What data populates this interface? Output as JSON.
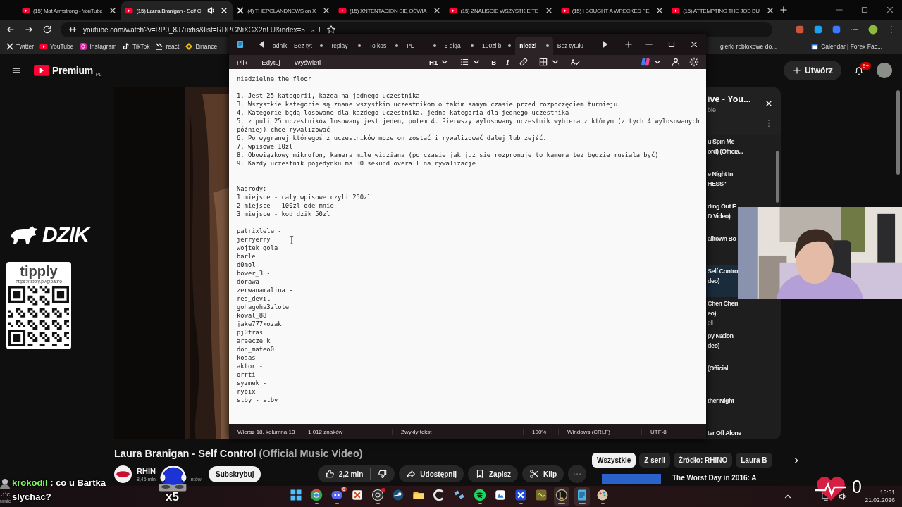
{
  "browser": {
    "tabs": [
      {
        "title": "(15) Mat Armstrong - YouTube",
        "kind": "youtube",
        "selected": false,
        "playing": false
      },
      {
        "title": "(15) Laura Branigan - Self C",
        "kind": "youtube",
        "selected": true,
        "playing": true
      },
      {
        "title": "(4) THEPOLANDNEWS on X",
        "kind": "x",
        "selected": false,
        "playing": false
      },
      {
        "title": "(15) XNTENTACION SIĘ OŚWIA",
        "kind": "youtube",
        "selected": false,
        "playing": false
      },
      {
        "title": "(15) ZNALIŚCIE WSZYSTKIE TE",
        "kind": "youtube",
        "selected": false,
        "playing": false
      },
      {
        "title": "(15) I BOUGHT A WRECKED FE",
        "kind": "youtube",
        "selected": false,
        "playing": false
      },
      {
        "title": "(15) ATTEMPTING THE JOB BU",
        "kind": "youtube",
        "selected": false,
        "playing": false
      }
    ],
    "address": "youtube.com/watch?v=RP0_8J7uxhs&list=RDPGNiXGX2nLU&index=5",
    "bookmarks": [
      {
        "label": "Twitter",
        "kind": "x"
      },
      {
        "label": "YouTube",
        "kind": "youtube"
      },
      {
        "label": "Instagram",
        "kind": "instagram"
      },
      {
        "label": "TikTok",
        "kind": "tiktok"
      },
      {
        "label": "react",
        "kind": "react"
      },
      {
        "label": "Binance",
        "kind": "binance"
      }
    ],
    "bookmarks_right": [
      {
        "label": "gierki robloxowe do...",
        "kind": "none"
      },
      {
        "label": "Calendar | Forex Fac...",
        "kind": "page"
      }
    ]
  },
  "youtube": {
    "logo": "Premium",
    "region": "PL",
    "create": "Utwórz",
    "notifications": "9+",
    "playlist": {
      "title": "ive - You...",
      "subtitle": "bie",
      "items": [
        {
          "lines": [
            "u Spin Me",
            "ord) (Officia..."
          ],
          "selected": false
        },
        {
          "lines": [
            "e Night In",
            "HESS\""
          ],
          "selected": false
        },
        {
          "lines": [
            "ding Out F",
            "D Video)"
          ],
          "selected": false
        },
        {
          "lines": [
            "alltown Bo"
          ],
          "selected": false
        },
        {
          "lines": [
            "Self Contro",
            "deo)"
          ],
          "selected": true
        },
        {
          "lines": [
            "Cheri Cheri",
            "eo)",
            "ell"
          ],
          "selected": false
        },
        {
          "lines": [
            "py Nation",
            "deo)"
          ],
          "selected": false
        },
        {
          "lines": [
            "(Official"
          ],
          "selected": false
        },
        {
          "lines": [
            "ther Night"
          ],
          "selected": false
        },
        {
          "lines": [
            "ter Off Alone"
          ],
          "selected": false
        }
      ]
    },
    "video": {
      "title": "Laura Branigan - Self Control",
      "title_suffix": "(Official Music Video)",
      "channel": "RHIN",
      "subscribers": "8,45 mln",
      "subscribers_tail": "ntów",
      "subscribe": "Subskrybuj",
      "likes": "2,2 mln",
      "actions": [
        {
          "label": "Udostępnij",
          "kind": "share"
        },
        {
          "label": "Zapisz",
          "kind": "save"
        },
        {
          "label": "Klip",
          "kind": "clip"
        }
      ]
    },
    "chips": [
      {
        "label": "Wszystkie",
        "selected": true
      },
      {
        "label": "Z serii",
        "selected": false
      },
      {
        "label": "Źródło: RHINO",
        "selected": false
      },
      {
        "label": "Laura B",
        "selected": false
      }
    ],
    "next_video": {
      "title": "The Worst Day in 2016: A"
    }
  },
  "notepad": {
    "tabs": [
      {
        "title": "adnik",
        "selected": false,
        "modified": false
      },
      {
        "title": "Bez tyt",
        "selected": false,
        "modified": true
      },
      {
        "title": "replay",
        "selected": false,
        "modified": true
      },
      {
        "title": "To kos",
        "selected": false,
        "modified": true
      },
      {
        "title": "PL",
        "selected": false,
        "modified": true
      },
      {
        "title": "5 giga",
        "selected": false,
        "modified": true
      },
      {
        "title": "100zl b",
        "selected": false,
        "modified": true
      },
      {
        "title": "niedzi",
        "selected": true,
        "modified": true
      },
      {
        "title": "Bez tytułu",
        "selected": false,
        "modified": false
      }
    ],
    "menu": [
      "Plik",
      "Edytuj",
      "Wyświetl"
    ],
    "heading": "H1",
    "format_buttons": [
      {
        "label": "B",
        "kind": "bold"
      },
      {
        "label": "I",
        "kind": "italic"
      }
    ],
    "text": "niedzielne the floor\n\n1. Jest 25 kategorii, każda na jednego uczestnika\n3. Wszystkie kategorie są znane wszystkim uczestnikom o takim samym czasie przed rozpoczęciem turnieju\n4. Kategorie będą losowane dla każdego uczestnika, jedna kategoria dla jednego uczestnika\n5. z puli 25 uczestników losowany jest jeden, potem 4. Pierwszy wylosowany uczestnik wybiera z którym (z tych 4 wylosowanych\npóźniej) chce rywalizować\n6. Po wygranej któregoś z uczestników może on zostać i rywalizować dalej lub zejść.\n7. wpisowe 10zl\n8. Obowiązkowy mikrofon, kamera mile widziana (po czasie jak już sie rozpromuje to kamera tez będzie musiala być)\n9. Każdy uczestnik pojedynku ma 30 sekund overall na rywalizacje\n\n\nNagrody:\n1 miejsce - caly wpisowe czyli 250zl\n2 miejsce - 100zl ode mnie\n3 miejsce - kod dzik 50zl\n\npatrixlele -\njerryerry\nwojtek_gola\nbarle\nd0mol\nbower_3 -\ndorawa -\nzerwanamalina -\nred_devil\ngohagoha3zlote\nkowal_88\njake777kozak\npj0tras\nareecze_k\ndon_mateo0\nkodas -\naktor -\norrti -\nsyzmek -\nrybix -\nstby - stby",
    "status": [
      "Wiersz 18, kolumna 13",
      "1 012 znaków",
      "Zwykły tekst",
      "100%",
      "Windows (CRLF)",
      "UTF-8"
    ]
  },
  "stream_overlay": {
    "brand": "DZIK",
    "tip_brand": "tipply",
    "tip_url": "https://tipply.pl/@patiro",
    "chat": {
      "user": "krokodil",
      "message": ": co u Bartka slychac?"
    },
    "emote_count": "x5",
    "heart_count": "0",
    "weather": "-1°C",
    "weather_tail": "urnie"
  },
  "taskbar": {
    "apps": [
      {
        "kind": "start",
        "running": false,
        "selected": false,
        "alert": false
      },
      {
        "kind": "chrome",
        "running": true,
        "selected": false,
        "alert": false
      },
      {
        "kind": "discord",
        "running": true,
        "selected": false,
        "alert": false,
        "badge": "6"
      },
      {
        "kind": "snip",
        "running": false,
        "selected": false,
        "alert": false
      },
      {
        "kind": "obs",
        "running": true,
        "selected": false,
        "alert": true
      },
      {
        "kind": "steam",
        "running": false,
        "selected": false,
        "alert": false
      },
      {
        "kind": "folder",
        "running": false,
        "selected": false,
        "alert": false
      },
      {
        "kind": "cleaner",
        "running": false,
        "selected": false,
        "alert": false
      },
      {
        "kind": "satellite",
        "running": false,
        "selected": false,
        "alert": false
      },
      {
        "kind": "spotify",
        "running": true,
        "selected": false,
        "alert": false
      },
      {
        "kind": "mail",
        "running": false,
        "selected": false,
        "alert": false
      },
      {
        "kind": "xmind",
        "running": true,
        "selected": false,
        "alert": false
      },
      {
        "kind": "block",
        "running": false,
        "selected": false,
        "alert": false
      },
      {
        "kind": "league",
        "running": true,
        "selected": true,
        "alert": false
      },
      {
        "kind": "notepad",
        "running": true,
        "selected": true,
        "alert": false
      },
      {
        "kind": "paint",
        "running": true,
        "selected": false,
        "alert": false
      }
    ],
    "time": "15:51",
    "date": "21.02.2026"
  }
}
